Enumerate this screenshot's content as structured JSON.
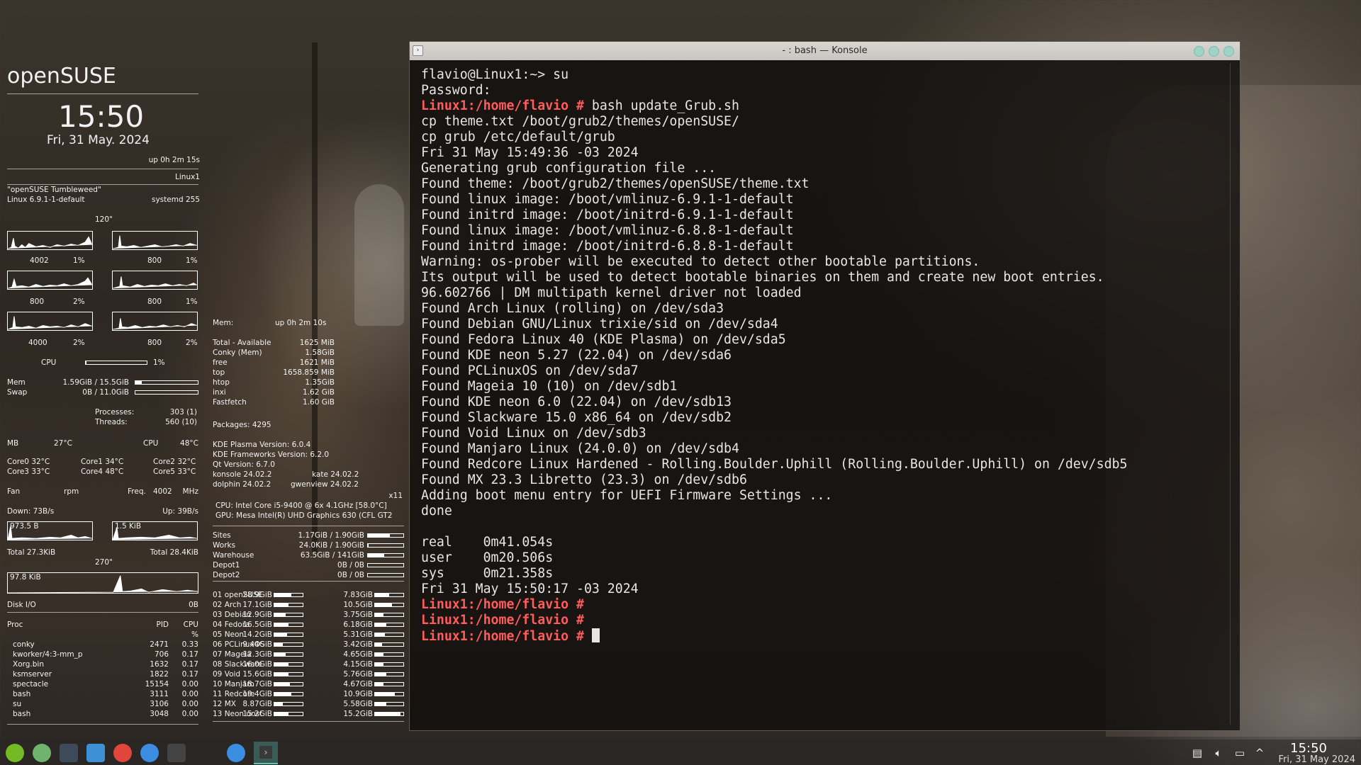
{
  "conky": {
    "distro": "openSUSE",
    "time": "15:50",
    "date": "Fri, 31 May. 2024",
    "uptime": "up  0h 2m 15s",
    "hostname": "Linux1",
    "os_name": "\"openSUSE Tumbleweed\"",
    "kernel": "Linux 6.9.1-1-default",
    "systemd": "systemd 255",
    "graph_label": "120\"",
    "cores": [
      {
        "freq": "4002",
        "pct": "1%"
      },
      {
        "freq": "800",
        "pct": "1%"
      },
      {
        "freq": "800",
        "pct": "2%"
      },
      {
        "freq": "800",
        "pct": "1%"
      },
      {
        "freq": "4000",
        "pct": "2%"
      },
      {
        "freq": "800",
        "pct": "2%"
      }
    ],
    "cpu_label": "CPU",
    "cpu_pct": "1%",
    "cpu_usage": 0.01,
    "mem_label": "Mem",
    "mem_value": "1.59GiB / 15.5GiB",
    "mem_usage": 0.1,
    "swap_label": "Swap",
    "swap_value": "0B / 11.0GiB",
    "swap_usage": 0.0,
    "processes_label": "Processes:",
    "processes_value": "303 (1)",
    "threads_label": "Threads:",
    "threads_value": "560 (10)",
    "mb_label": "MB",
    "mb_temp": "27°C",
    "cpu_temp_label": "CPU",
    "cpu_temp": "48°C",
    "core_temps": [
      "Core0  32°C",
      "Core1  34°C",
      "Core2  32°C",
      "Core3  33°C",
      "Core4  48°C",
      "Core5  33°C"
    ],
    "fan_label": "Fan",
    "fan_unit": "rpm",
    "freq_label": "Freq.",
    "freq_value": "4002",
    "freq_unit": "MHz",
    "down_label": "Down: 73B/s",
    "up_label": "Up: 39B/s",
    "down_graph_label": "973.5 B",
    "up_graph_label": "1.5 KiB",
    "total_down": "Total 27.3KiB",
    "total_up": "Total 28.4KiB",
    "disk_graph_top": "270\"",
    "disk_graph_label": "97.8 KiB",
    "disk_io_label": "Disk I/O",
    "disk_io_value": "0B",
    "proc_header": {
      "name": "Proc",
      "pid": "PID",
      "cpu": "CPU",
      "unit": "%"
    },
    "processes": [
      {
        "name": "conky",
        "pid": "2471",
        "cpu": "0.33"
      },
      {
        "name": "kworker/4:3-mm_p",
        "pid": "706",
        "cpu": "0.17"
      },
      {
        "name": "Xorg.bin",
        "pid": "1632",
        "cpu": "0.17"
      },
      {
        "name": "ksmserver",
        "pid": "1822",
        "cpu": "0.17"
      },
      {
        "name": "spectacle",
        "pid": "15154",
        "cpu": "0.00"
      },
      {
        "name": "bash",
        "pid": "3111",
        "cpu": "0.00"
      },
      {
        "name": "su",
        "pid": "3106",
        "cpu": "0.00"
      },
      {
        "name": "bash",
        "pid": "3048",
        "cpu": "0.00"
      }
    ]
  },
  "conky2": {
    "mem_label": "Mem:",
    "uptime": "up  0h 2m 10s",
    "mem_rows": [
      {
        "label": "Total - Available",
        "value": "1625 MiB"
      },
      {
        "label": "Conky (Mem)",
        "value": "1.58GiB"
      },
      {
        "label": "free",
        "value": "1621    MiB"
      },
      {
        "label": "top",
        "value": "1658.859  MiB"
      },
      {
        "label": "htop",
        "value": "1.35GiB"
      },
      {
        "label": "inxi",
        "value": "1.62 GiB"
      },
      {
        "label": "Fastfetch",
        "value": "1.60 GiB"
      }
    ],
    "packages": "Packages: 4295",
    "plasma": "KDE Plasma Version: 6.0.4",
    "frameworks": "KDE Frameworks Version: 6.2.0",
    "qt": "Qt Version: 6.7.0",
    "konsole": "konsole 24.02.2",
    "kate": "kate 24.02.2",
    "dolphin": "dolphin 24.02.2",
    "gwenview": "gwenview 24.02.2",
    "session": "x11",
    "cpu_info": "CPU: Intel Core i5-9400 @ 6x 4.1GHz [58.0°C]",
    "gpu_info": "GPU: Mesa Intel(R) UHD Graphics 630 (CFL GT2",
    "storage": [
      {
        "name": "Sites",
        "value": "1.17GiB  /  1.90GiB",
        "usage": 0.62
      },
      {
        "name": "Works",
        "value": "24.0KiB  /  1.90GiB",
        "usage": 0.02
      },
      {
        "name": "Warehouse",
        "value": "63.5GiB  /  141GiB",
        "usage": 0.45
      },
      {
        "name": "Depot1",
        "value": "0B  /  0B",
        "usage": 0.0
      },
      {
        "name": "Depot2",
        "value": "0B  /  0B",
        "usage": 0.0
      }
    ],
    "partitions": [
      {
        "name": "01 openSUSE",
        "used": "28.9GiB",
        "u1": 0.6,
        "free": "7.83GiB",
        "u2": 0.5
      },
      {
        "name": "02 Arch",
        "used": "17.1GiB",
        "u1": 0.5,
        "free": "10.5GiB",
        "u2": 0.6
      },
      {
        "name": "03 Debian",
        "used": "12.9GiB",
        "u1": 0.4,
        "free": "3.75GiB",
        "u2": 0.3
      },
      {
        "name": "04 Fedora",
        "used": "16.5GiB",
        "u1": 0.5,
        "free": "6.18GiB",
        "u2": 0.4
      },
      {
        "name": "05 Neon",
        "used": "14.2GiB",
        "u1": 0.45,
        "free": "5.31GiB",
        "u2": 0.35
      },
      {
        "name": "06 PCLinuxOS",
        "used": "9.44GiB",
        "u1": 0.3,
        "free": "3.42GiB",
        "u2": 0.25
      },
      {
        "name": "07 Mageia",
        "used": "12.3GiB",
        "u1": 0.4,
        "free": "4.65GiB",
        "u2": 0.3
      },
      {
        "name": "08 Slackware",
        "used": "16.0GiB",
        "u1": 0.5,
        "free": "4.15GiB",
        "u2": 0.3
      },
      {
        "name": "09 Void",
        "used": "15.6GiB",
        "u1": 0.5,
        "free": "5.76GiB",
        "u2": 0.4
      },
      {
        "name": "10 Manjaro",
        "used": "18.7GiB",
        "u1": 0.55,
        "free": "4.67GiB",
        "u2": 0.3
      },
      {
        "name": "11 Redcore",
        "used": "19.4GiB",
        "u1": 0.6,
        "free": "10.9GiB",
        "u2": 0.7
      },
      {
        "name": "12 MX",
        "used": "8.87GiB",
        "u1": 0.3,
        "free": "5.58GiB",
        "u2": 0.4
      },
      {
        "name": "13 Neon unst",
        "used": "15.2GiB",
        "u1": 0.5,
        "free": "15.2GiB",
        "u2": 0.9
      }
    ]
  },
  "konsole": {
    "title": "- : bash — Konsole",
    "lines": [
      {
        "text": "flavio@Linux1:~> su"
      },
      {
        "text": "Password:"
      },
      {
        "prompt": "Linux1:/home/flavio #",
        "text": " bash update_Grub.sh"
      },
      {
        "text": "cp theme.txt /boot/grub2/themes/openSUSE/"
      },
      {
        "text": "cp grub /etc/default/grub"
      },
      {
        "text": "Fri 31 May 15:49:36 -03 2024"
      },
      {
        "text": "Generating grub configuration file ..."
      },
      {
        "text": "Found theme: /boot/grub2/themes/openSUSE/theme.txt"
      },
      {
        "text": "Found linux image: /boot/vmlinuz-6.9.1-1-default"
      },
      {
        "text": "Found initrd image: /boot/initrd-6.9.1-1-default"
      },
      {
        "text": "Found linux image: /boot/vmlinuz-6.8.8-1-default"
      },
      {
        "text": "Found initrd image: /boot/initrd-6.8.8-1-default"
      },
      {
        "text": "Warning: os-prober will be executed to detect other bootable partitions."
      },
      {
        "text": "Its output will be used to detect bootable binaries on them and create new boot entries."
      },
      {
        "text": "96.602766 | DM multipath kernel driver not loaded"
      },
      {
        "text": "Found Arch Linux (rolling) on /dev/sda3"
      },
      {
        "text": "Found Debian GNU/Linux trixie/sid on /dev/sda4"
      },
      {
        "text": "Found Fedora Linux 40 (KDE Plasma) on /dev/sda5"
      },
      {
        "text": "Found KDE neon 5.27 (22.04) on /dev/sda6"
      },
      {
        "text": "Found PCLinuxOS on /dev/sda7"
      },
      {
        "text": "Found Mageia 10 (10) on /dev/sdb1"
      },
      {
        "text": "Found KDE neon 6.0 (22.04) on /dev/sdb13"
      },
      {
        "text": "Found Slackware 15.0 x86_64 on /dev/sdb2"
      },
      {
        "text": "Found Void Linux on /dev/sdb3"
      },
      {
        "text": "Found Manjaro Linux (24.0.0) on /dev/sdb4"
      },
      {
        "text": "Found Redcore Linux Hardened - Rolling.Boulder.Uphill (Rolling.Boulder.Uphill) on /dev/sdb5"
      },
      {
        "text": "Found MX 23.3 Libretto (23.3) on /dev/sdb6"
      },
      {
        "text": "Adding boot menu entry for UEFI Firmware Settings ..."
      },
      {
        "text": "done"
      },
      {
        "text": ""
      },
      {
        "text": "real    0m41.054s"
      },
      {
        "text": "user    0m20.506s"
      },
      {
        "text": "sys     0m21.358s"
      },
      {
        "text": "Fri 31 May 15:50:17 -03 2024"
      },
      {
        "prompt": "Linux1:/home/flavio #",
        "text": ""
      },
      {
        "prompt": "Linux1:/home/flavio #",
        "text": ""
      },
      {
        "prompt": "Linux1:/home/flavio #",
        "text": " ",
        "cursor": true
      }
    ]
  },
  "taskbar": {
    "launchers": [
      {
        "name": "application-launcher-icon",
        "color": "#73ba25"
      },
      {
        "name": "home-folder-icon",
        "color": "#6fb36f"
      },
      {
        "name": "system-settings-icon",
        "color": "#3c4a5a"
      },
      {
        "name": "file-manager-icon",
        "color": "#3d8fd6"
      },
      {
        "name": "chrome-icon",
        "color": "#e0463b"
      },
      {
        "name": "thunderbird-icon",
        "color": "#3a8de0"
      },
      {
        "name": "konsole-launcher-icon",
        "color": "#444"
      }
    ],
    "time": "15:50",
    "date": "Fri, 31 May 2024"
  },
  "colors": {
    "prompt": "#ff5c5c",
    "terminal_text": "#e6e6e6",
    "opensuse_green": "#73ba25"
  }
}
